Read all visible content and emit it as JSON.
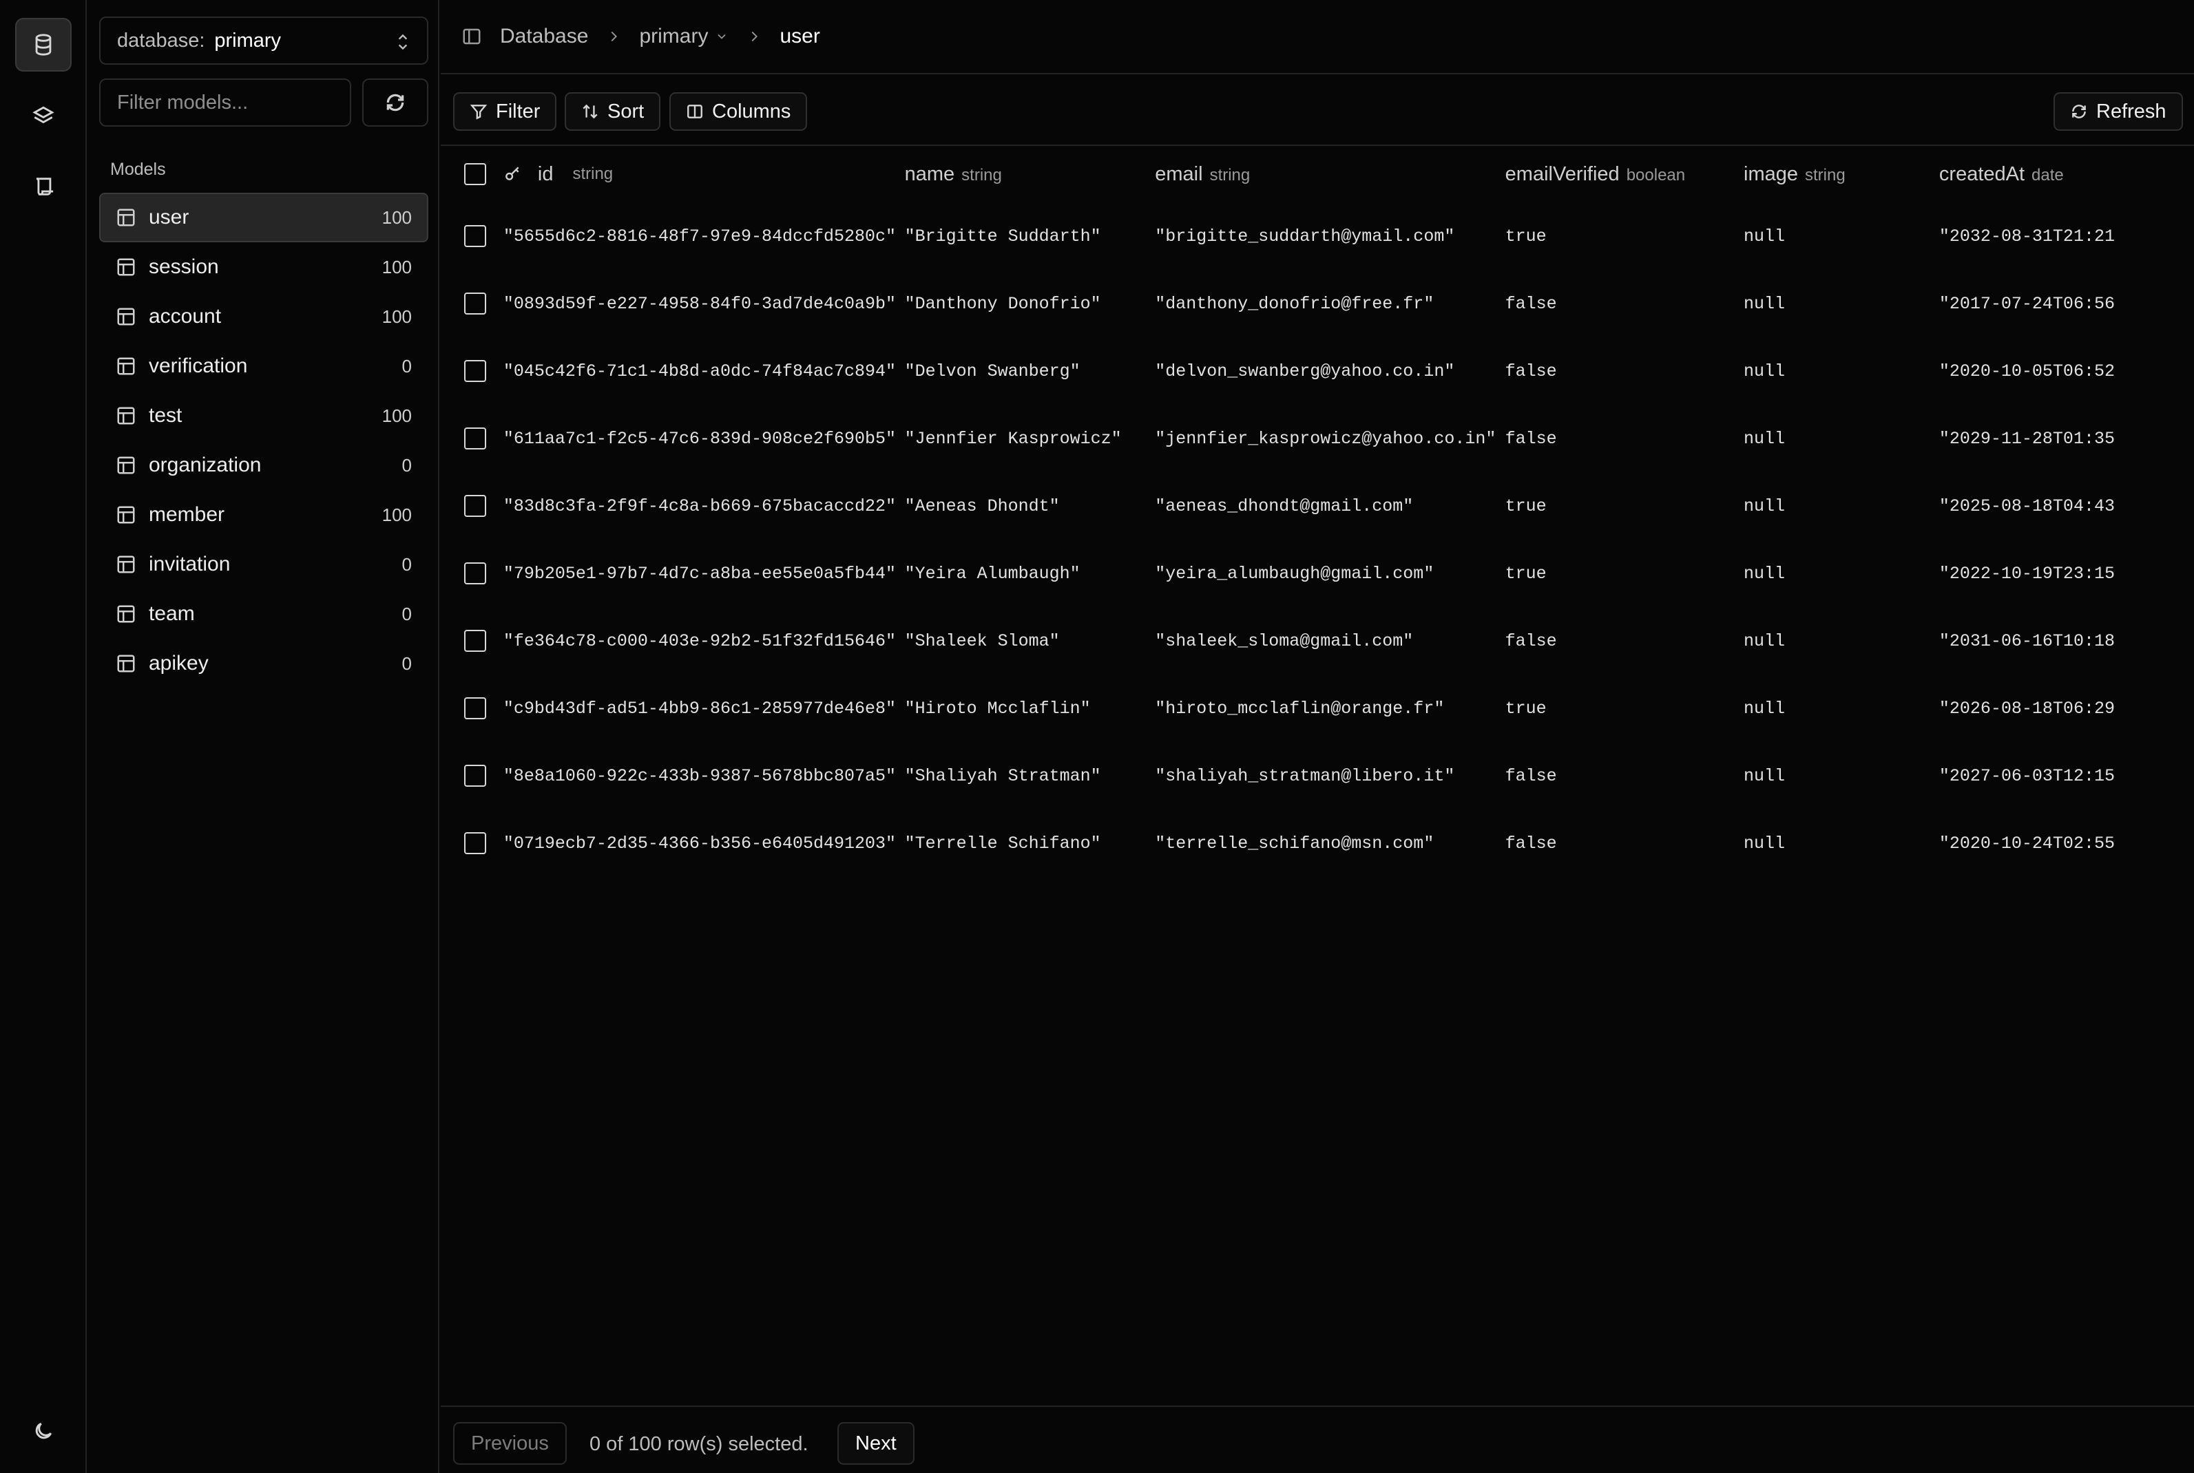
{
  "sidebar_rail": {
    "items": [
      {
        "icon": "database-icon",
        "active": true
      },
      {
        "icon": "layers-icon",
        "active": false
      },
      {
        "icon": "scroll-icon",
        "active": false
      }
    ],
    "theme_icon": "moon-icon"
  },
  "models_panel": {
    "db_label": "database:",
    "db_value": "primary",
    "filter_placeholder": "Filter models...",
    "section_title": "Models",
    "items": [
      {
        "name": "user",
        "count": "100",
        "active": true
      },
      {
        "name": "session",
        "count": "100"
      },
      {
        "name": "account",
        "count": "100"
      },
      {
        "name": "verification",
        "count": "0"
      },
      {
        "name": "test",
        "count": "100"
      },
      {
        "name": "organization",
        "count": "0"
      },
      {
        "name": "member",
        "count": "100"
      },
      {
        "name": "invitation",
        "count": "0"
      },
      {
        "name": "team",
        "count": "0"
      },
      {
        "name": "apikey",
        "count": "0"
      }
    ]
  },
  "breadcrumb": {
    "root": "Database",
    "db": "primary",
    "model": "user"
  },
  "toolbar": {
    "filter": "Filter",
    "sort": "Sort",
    "columns": "Columns",
    "refresh": "Refresh"
  },
  "table": {
    "columns": [
      {
        "name": "id",
        "type": "string"
      },
      {
        "name": "name",
        "type": "string"
      },
      {
        "name": "email",
        "type": "string"
      },
      {
        "name": "emailVerified",
        "type": "boolean"
      },
      {
        "name": "image",
        "type": "string"
      },
      {
        "name": "createdAt",
        "type": "date"
      }
    ],
    "rows": [
      [
        "\"5655d6c2-8816-48f7-97e9-84dccfd5280c\"",
        "\"Brigitte Suddarth\"",
        "\"brigitte_suddarth@ymail.com\"",
        "true",
        "null",
        "\"2032-08-31T21:21"
      ],
      [
        "\"0893d59f-e227-4958-84f0-3ad7de4c0a9b\"",
        "\"Danthony Donofrio\"",
        "\"danthony_donofrio@free.fr\"",
        "false",
        "null",
        "\"2017-07-24T06:56"
      ],
      [
        "\"045c42f6-71c1-4b8d-a0dc-74f84ac7c894\"",
        "\"Delvon Swanberg\"",
        "\"delvon_swanberg@yahoo.co.in\"",
        "false",
        "null",
        "\"2020-10-05T06:52"
      ],
      [
        "\"611aa7c1-f2c5-47c6-839d-908ce2f690b5\"",
        "\"Jennfier Kasprowicz\"",
        "\"jennfier_kasprowicz@yahoo.co.in\"",
        "false",
        "null",
        "\"2029-11-28T01:35"
      ],
      [
        "\"83d8c3fa-2f9f-4c8a-b669-675bacaccd22\"",
        "\"Aeneas Dhondt\"",
        "\"aeneas_dhondt@gmail.com\"",
        "true",
        "null",
        "\"2025-08-18T04:43"
      ],
      [
        "\"79b205e1-97b7-4d7c-a8ba-ee55e0a5fb44\"",
        "\"Yeira Alumbaugh\"",
        "\"yeira_alumbaugh@gmail.com\"",
        "true",
        "null",
        "\"2022-10-19T23:15"
      ],
      [
        "\"fe364c78-c000-403e-92b2-51f32fd15646\"",
        "\"Shaleek Sloma\"",
        "\"shaleek_sloma@gmail.com\"",
        "false",
        "null",
        "\"2031-06-16T10:18"
      ],
      [
        "\"c9bd43df-ad51-4bb9-86c1-285977de46e8\"",
        "\"Hiroto Mcclaflin\"",
        "\"hiroto_mcclaflin@orange.fr\"",
        "true",
        "null",
        "\"2026-08-18T06:29"
      ],
      [
        "\"8e8a1060-922c-433b-9387-5678bbc807a5\"",
        "\"Shaliyah Stratman\"",
        "\"shaliyah_stratman@libero.it\"",
        "false",
        "null",
        "\"2027-06-03T12:15"
      ],
      [
        "\"0719ecb7-2d35-4366-b356-e6405d491203\"",
        "\"Terrelle Schifano\"",
        "\"terrelle_schifano@msn.com\"",
        "false",
        "null",
        "\"2020-10-24T02:55"
      ]
    ]
  },
  "footer": {
    "previous": "Previous",
    "status": "0 of 100 row(s) selected.",
    "next": "Next"
  }
}
